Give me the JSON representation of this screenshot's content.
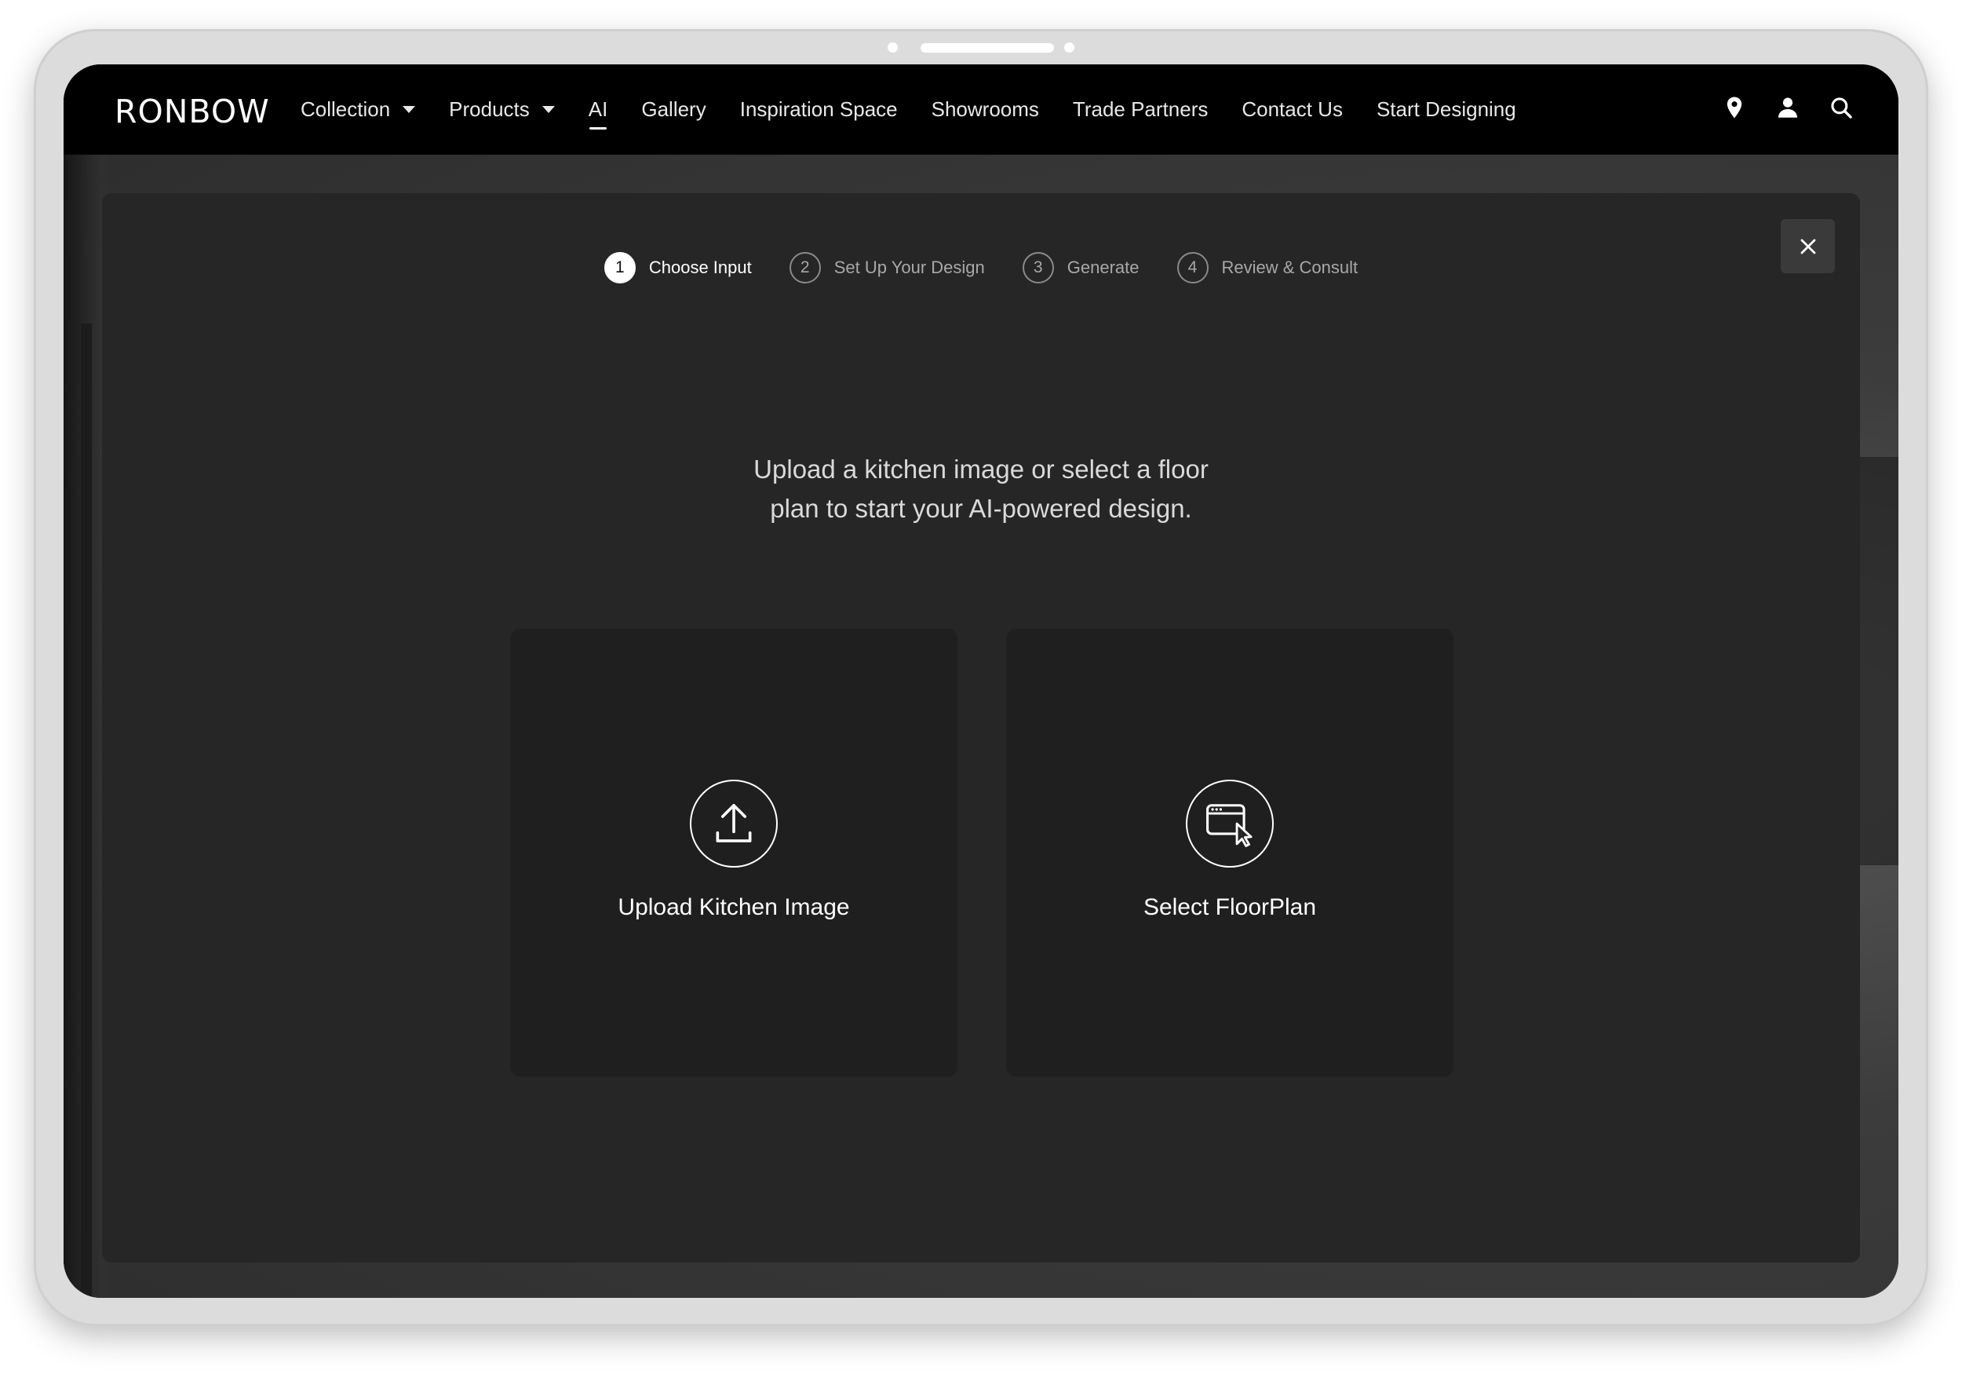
{
  "brand": {
    "logo_text": "RONBOW"
  },
  "nav": {
    "items": [
      {
        "label": "Collection",
        "has_dropdown": true,
        "active": false
      },
      {
        "label": "Products",
        "has_dropdown": true,
        "active": false
      },
      {
        "label": "AI",
        "has_dropdown": false,
        "active": true
      },
      {
        "label": "Gallery",
        "has_dropdown": false,
        "active": false
      },
      {
        "label": "Inspiration Space",
        "has_dropdown": false,
        "active": false
      },
      {
        "label": "Showrooms",
        "has_dropdown": false,
        "active": false
      },
      {
        "label": "Trade Partners",
        "has_dropdown": false,
        "active": false
      },
      {
        "label": "Contact Us",
        "has_dropdown": false,
        "active": false
      },
      {
        "label": "Start Designing",
        "has_dropdown": false,
        "active": false
      }
    ],
    "icons": [
      "location-pin-icon",
      "user-icon",
      "search-icon"
    ]
  },
  "modal": {
    "close_icon": "close-icon",
    "steps": [
      {
        "number": "1",
        "label": "Choose Input",
        "active": true
      },
      {
        "number": "2",
        "label": "Set Up Your Design",
        "active": false
      },
      {
        "number": "3",
        "label": "Generate",
        "active": false
      },
      {
        "number": "4",
        "label": "Review & Consult",
        "active": false
      }
    ],
    "intro_line1": "Upload a kitchen image or select a floor",
    "intro_line2": "plan to start your AI-powered design.",
    "options": {
      "upload": {
        "label": "Upload Kitchen Image",
        "icon": "upload-icon"
      },
      "floorplan": {
        "label": "Select FloorPlan",
        "icon": "browser-cursor-icon"
      }
    }
  },
  "colors": {
    "nav_bg": "#000000",
    "modal_bg": "#262626",
    "card_bg": "#1f1f1f",
    "text_primary": "#ffffff",
    "text_muted": "#a8a8a8"
  }
}
